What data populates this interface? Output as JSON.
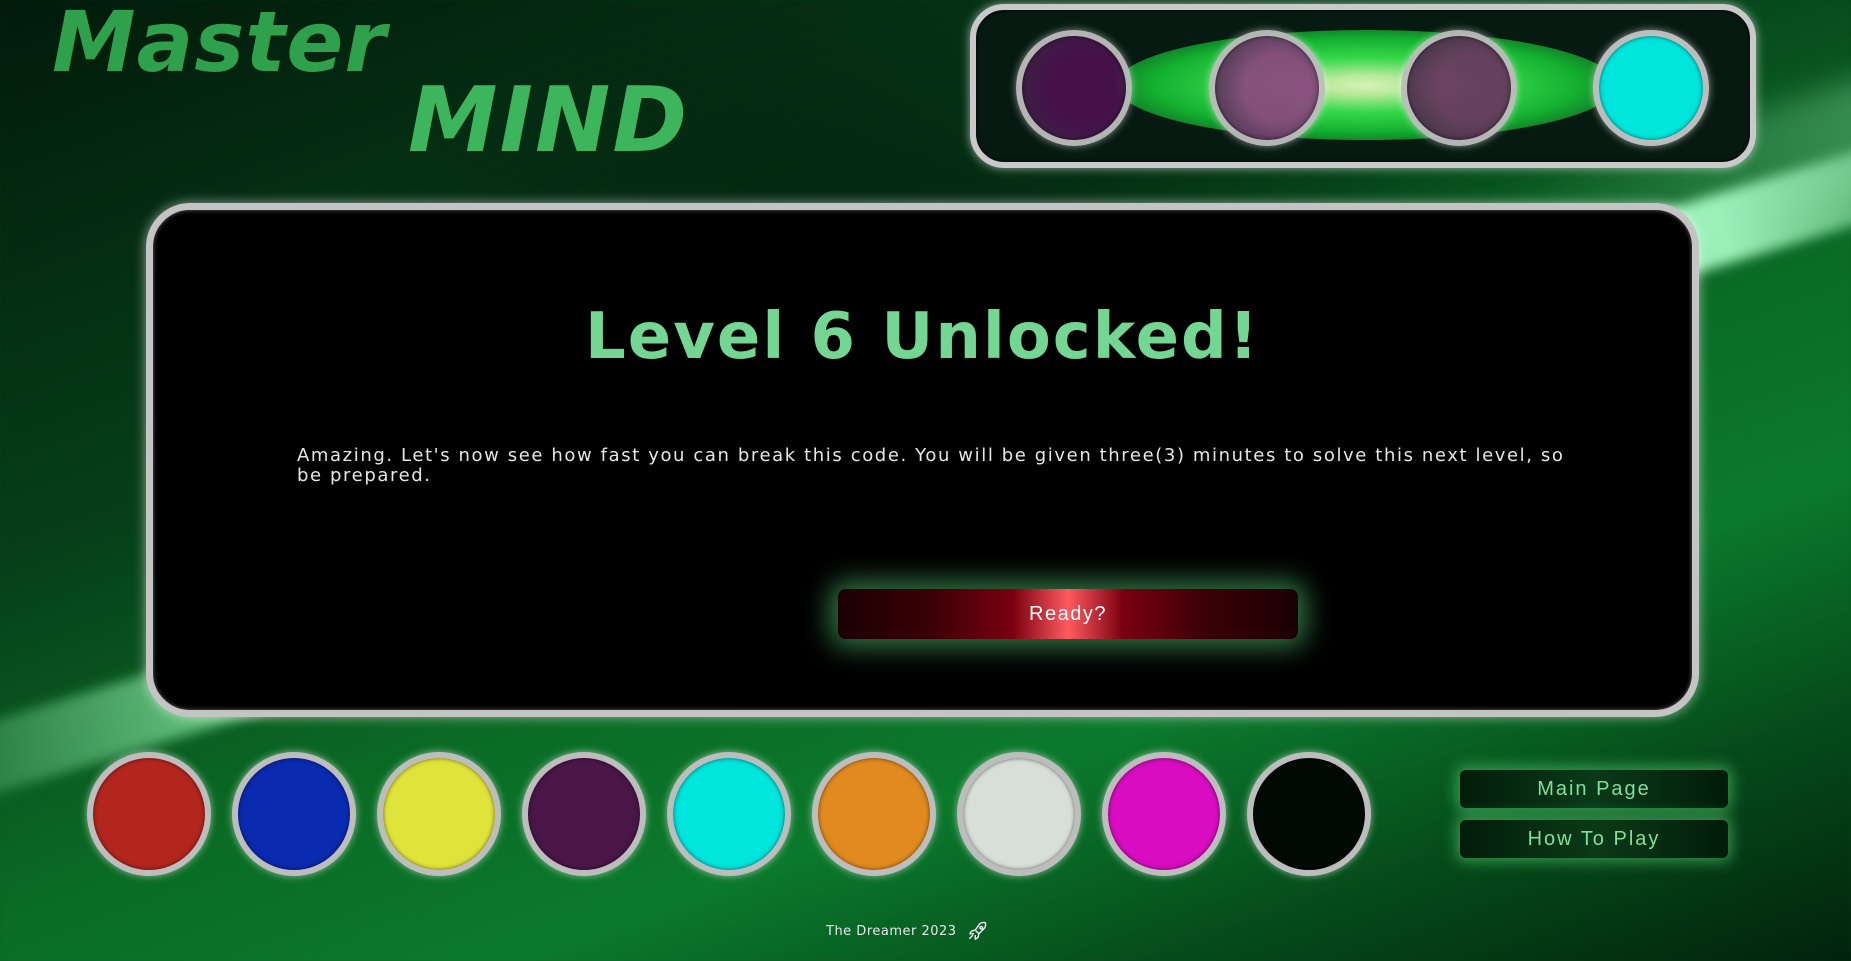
{
  "logo": {
    "word1": "Master",
    "word2": "MIND"
  },
  "secret_code": {
    "pegs": [
      {
        "color": "#4a1050",
        "state": "hidden"
      },
      {
        "color": "#8a4a80",
        "state": "hidden"
      },
      {
        "color": "#6a3a60",
        "state": "hidden"
      },
      {
        "color": "#00e5dc",
        "state": "revealed"
      }
    ]
  },
  "dialog": {
    "title": "Level 6 Unlocked!",
    "message": "Amazing. Let's now see how fast you can break this code. You will be given three(3) minutes to solve this next level, so be prepared.",
    "ready_label": "Ready?"
  },
  "palette": {
    "colors": [
      "#b3261e",
      "#0a2ab0",
      "#e0e33a",
      "#4a1648",
      "#00e5dc",
      "#e08a20",
      "#d8dfd8",
      "#d80cc0",
      "#000a04"
    ]
  },
  "nav": {
    "main_page_label": "Main Page",
    "how_to_play_label": "How To Play"
  },
  "footer": {
    "credit": "The Dreamer 2023",
    "icon": "rocket-icon"
  },
  "theme": {
    "accent": "#73d793",
    "panel_border": "#c4c4c4"
  }
}
